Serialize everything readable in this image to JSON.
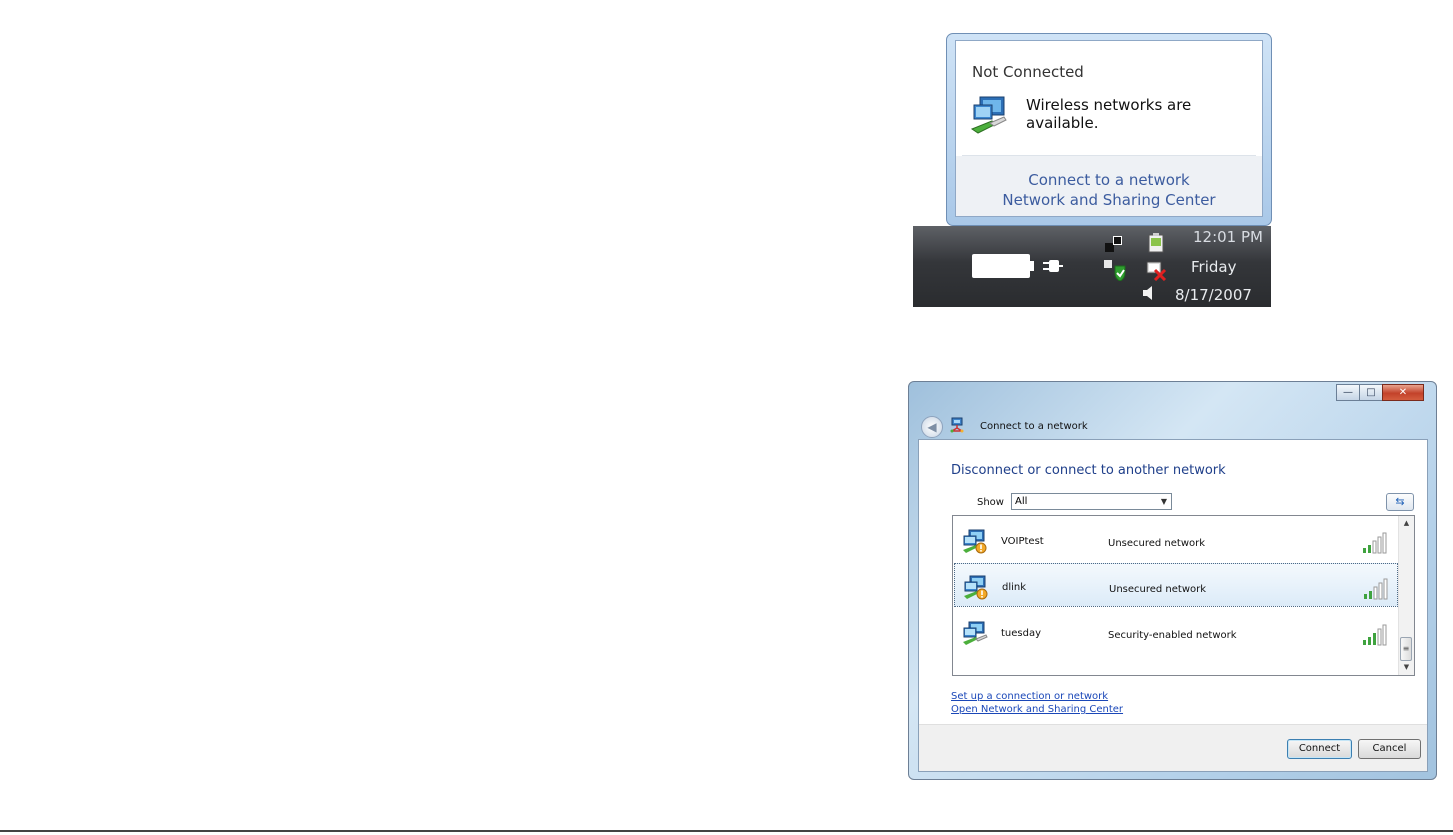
{
  "popup": {
    "title": "Not Connected",
    "message": "Wireless networks are available.",
    "links": [
      "Connect to a network",
      "Network and Sharing Center"
    ]
  },
  "taskbar": {
    "time": "12:01 PM",
    "day": "Friday",
    "date": "8/17/2007",
    "icons": [
      "battery-icon",
      "power-plug-icon",
      "network-activity-icon",
      "security-center-icon",
      "device-icon",
      "network-disconnected-icon",
      "volume-icon"
    ]
  },
  "window": {
    "title": "Connect to a network",
    "heading": "Disconnect or connect to another network",
    "show_label": "Show",
    "show_value": "All",
    "networks": [
      {
        "name": "VOIPtest",
        "status": "Unsecured network",
        "selected": false
      },
      {
        "name": "dlink",
        "status": "Unsecured network",
        "selected": true
      },
      {
        "name": "tuesday",
        "status": "Security-enabled network",
        "selected": false
      }
    ],
    "links": [
      "Set up a connection or network",
      "Open Network and Sharing Center"
    ],
    "buttons": {
      "connect": "Connect",
      "cancel": "Cancel"
    }
  },
  "colors": {
    "link": "#1a47b8",
    "heading": "#1f3f8a",
    "selected_row": "#dcebf8",
    "close_button": "#c3422a"
  }
}
